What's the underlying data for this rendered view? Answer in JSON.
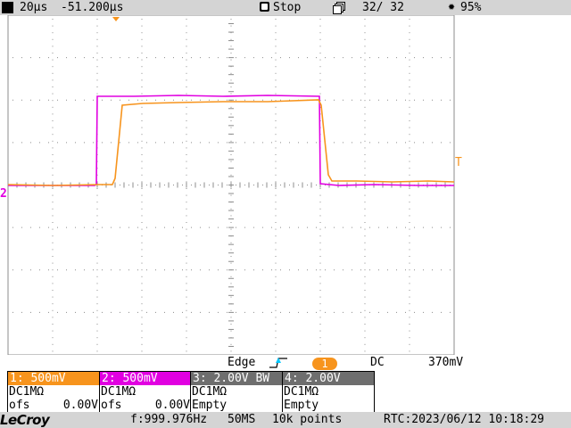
{
  "top_bar": {
    "timebase": "20µs",
    "delay": "-51.200µs",
    "run_state": "Stop",
    "acquisitions": "32/  32",
    "battery": "95%"
  },
  "screen": {
    "left_marker_label": "2",
    "right_marker_label": "T",
    "channel1_color": "#f7941d",
    "channel2_color": "#e100e1",
    "grid_color": "#8c8c8c"
  },
  "trigger": {
    "type_label": "Edge",
    "slope_icon": "rising-edge-icon",
    "source": "1",
    "coupling": "DC",
    "level": "370mV"
  },
  "channels": [
    {
      "header": "1: 500mV",
      "coupling": "DC1MΩ",
      "offset_label": "ofs",
      "offset_value": "0.00V",
      "color": "#f7941d",
      "header_text_color": "#ffffff"
    },
    {
      "header": "2: 500mV",
      "coupling": "DC1MΩ",
      "offset_label": "ofs",
      "offset_value": "0.00V",
      "color": "#e100e1",
      "header_text_color": "#ffffff"
    },
    {
      "header": "3: 2.00V  BW",
      "coupling": "DC1MΩ",
      "offset_label": "Empty",
      "offset_value": "",
      "color": "#6e6e6e",
      "header_text_color": "#ffffff"
    },
    {
      "header": "4: 2.00V",
      "coupling": "DC1MΩ",
      "offset_label": "Empty",
      "offset_value": "",
      "color": "#6e6e6e",
      "header_text_color": "#ffffff"
    }
  ],
  "status_bar": {
    "brand": "LeCroy",
    "frequency": "f:999.976Hz",
    "sample_rate": "50MS",
    "record_length": "10k points",
    "rtc": "RTC:2023/06/12 10:18:29"
  }
}
